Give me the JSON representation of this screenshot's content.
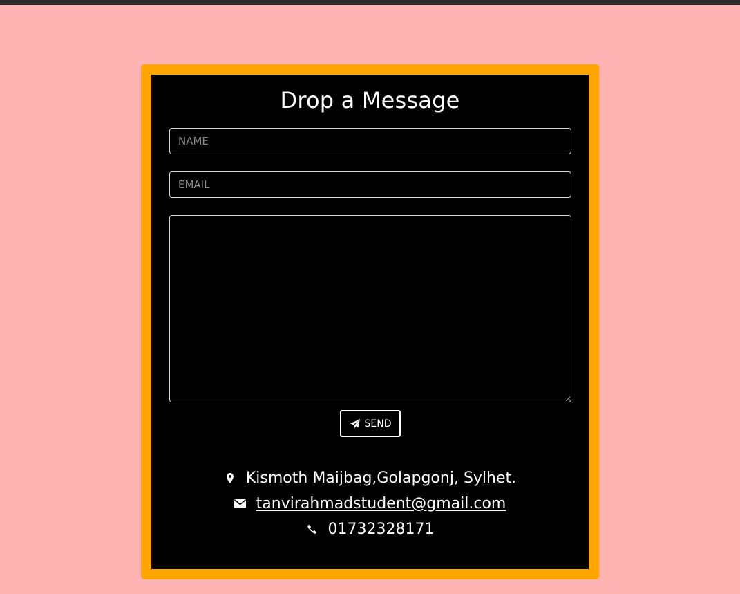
{
  "form": {
    "title": "Drop a Message",
    "name_placeholder": "NAME",
    "email_placeholder": "EMAIL",
    "message_value": "",
    "send_label": "SEND"
  },
  "contact": {
    "address": "Kismoth Maijbag,Golapgonj, Sylhet.",
    "email": "tanvirahmadstudent@gmail.com",
    "phone": "01732328171"
  },
  "icons": {
    "send": "paper-plane-icon",
    "address": "map-marker-icon",
    "email": "envelope-icon",
    "phone": "phone-icon"
  },
  "colors": {
    "background": "#ffb3b3",
    "frame": "#ffa500",
    "card": "#000000",
    "text": "#ffffff"
  }
}
